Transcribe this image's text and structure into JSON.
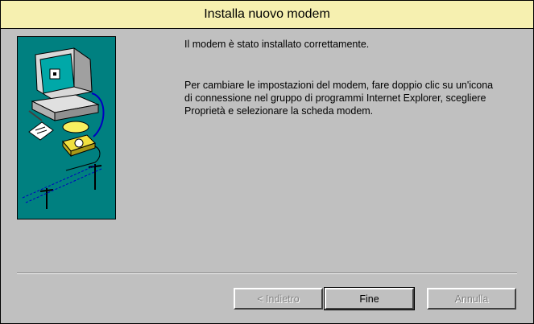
{
  "window": {
    "title": "Installa nuovo modem"
  },
  "message": {
    "line1": "Il modem è stato installato correttamente.",
    "line2": "Per cambiare le impostazioni del modem, fare doppio clic su un'icona di connessione nel gruppo di programmi Internet Explorer, scegliere Proprietà e selezionare la scheda modem."
  },
  "buttons": {
    "back": "< Indietro",
    "finish": "Fine",
    "cancel": "Annulla"
  },
  "colors": {
    "titlebar": "#f6f0b0",
    "dialog": "#c0c0c0",
    "illustration_bg": "#008080"
  }
}
